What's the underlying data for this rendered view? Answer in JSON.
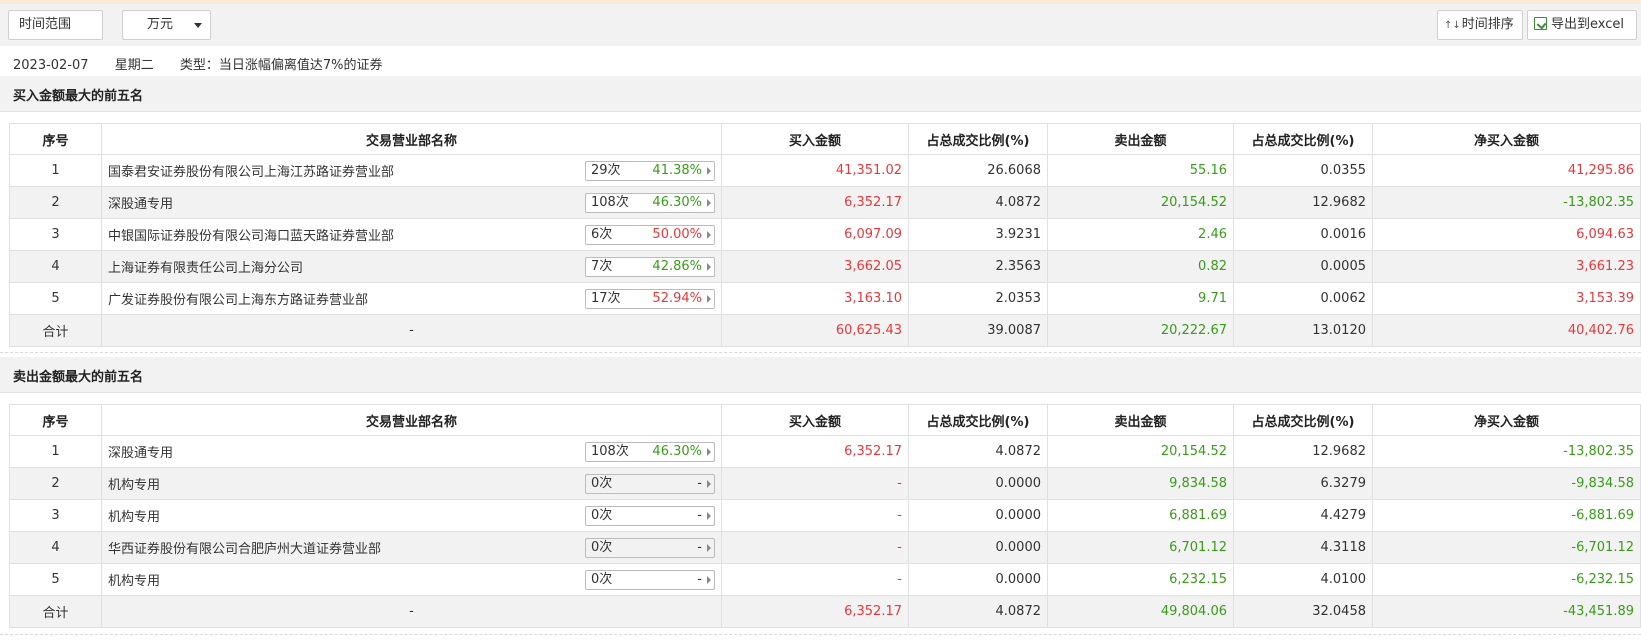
{
  "toolbar": {
    "range_label": "时间范围",
    "unit_label": "万元",
    "sort_icon": "↑↓",
    "sort_label": "时间排序",
    "export_label": "导出到excel"
  },
  "info": {
    "date": "2023-02-07",
    "weekday": "星期二",
    "type": "类型：当日涨幅偏离值达7%的证券"
  },
  "colors": {
    "up": "#e4393c",
    "down": "#3a9b1b",
    "header_bg": "#f2f2f2"
  },
  "columns": [
    "序号",
    "交易营业部名称",
    "买入金额",
    "占总成交比例(%)",
    "卖出金额",
    "占总成交比例(%)",
    "净买入金额"
  ],
  "buy_section": {
    "title": "买入金额最大的前五名",
    "rows": [
      {
        "no": "1",
        "name": "国泰君安证券股份有限公司上海江苏路证券营业部",
        "times": "29次",
        "pct": "41.38%",
        "buy": "41,351.02",
        "buy_ratio": "26.6068",
        "sell": "55.16",
        "sell_ratio": "0.0355",
        "net": "41,295.86"
      },
      {
        "no": "2",
        "name": "深股通专用",
        "times": "108次",
        "pct": "46.30%",
        "buy": "6,352.17",
        "buy_ratio": "4.0872",
        "sell": "20,154.52",
        "sell_ratio": "12.9682",
        "net": "-13,802.35"
      },
      {
        "no": "3",
        "name": "中银国际证券股份有限公司海口蓝天路证券营业部",
        "times": "6次",
        "pct": "50.00%",
        "buy": "6,097.09",
        "buy_ratio": "3.9231",
        "sell": "2.46",
        "sell_ratio": "0.0016",
        "net": "6,094.63"
      },
      {
        "no": "4",
        "name": "上海证券有限责任公司上海分公司",
        "times": "7次",
        "pct": "42.86%",
        "buy": "3,662.05",
        "buy_ratio": "2.3563",
        "sell": "0.82",
        "sell_ratio": "0.0005",
        "net": "3,661.23"
      },
      {
        "no": "5",
        "name": "广发证券股份有限公司上海东方路证券营业部",
        "times": "17次",
        "pct": "52.94%",
        "buy": "3,163.10",
        "buy_ratio": "2.0353",
        "sell": "9.71",
        "sell_ratio": "0.0062",
        "net": "3,153.39"
      }
    ],
    "total": {
      "label": "合计",
      "name": "-",
      "buy": "60,625.43",
      "buy_ratio": "39.0087",
      "sell": "20,222.67",
      "sell_ratio": "13.0120",
      "net": "40,402.76"
    }
  },
  "sell_section": {
    "title": "卖出金额最大的前五名",
    "rows": [
      {
        "no": "1",
        "name": "深股通专用",
        "times": "108次",
        "pct": "46.30%",
        "buy": "6,352.17",
        "buy_ratio": "4.0872",
        "sell": "20,154.52",
        "sell_ratio": "12.9682",
        "net": "-13,802.35"
      },
      {
        "no": "2",
        "name": "机构专用",
        "times": "0次",
        "pct": "-",
        "buy": "-",
        "buy_ratio": "0.0000",
        "sell": "9,834.58",
        "sell_ratio": "6.3279",
        "net": "-9,834.58"
      },
      {
        "no": "3",
        "name": "机构专用",
        "times": "0次",
        "pct": "-",
        "buy": "-",
        "buy_ratio": "0.0000",
        "sell": "6,881.69",
        "sell_ratio": "4.4279",
        "net": "-6,881.69"
      },
      {
        "no": "4",
        "name": "华西证券股份有限公司合肥庐州大道证券营业部",
        "times": "0次",
        "pct": "-",
        "buy": "-",
        "buy_ratio": "0.0000",
        "sell": "6,701.12",
        "sell_ratio": "4.3118",
        "net": "-6,701.12"
      },
      {
        "no": "5",
        "name": "机构专用",
        "times": "0次",
        "pct": "-",
        "buy": "-",
        "buy_ratio": "0.0000",
        "sell": "6,232.15",
        "sell_ratio": "4.0100",
        "net": "-6,232.15"
      }
    ],
    "total": {
      "label": "合计",
      "name": "-",
      "buy": "6,352.17",
      "buy_ratio": "4.0872",
      "sell": "49,804.06",
      "sell_ratio": "32.0458",
      "net": "-43,451.89"
    }
  }
}
